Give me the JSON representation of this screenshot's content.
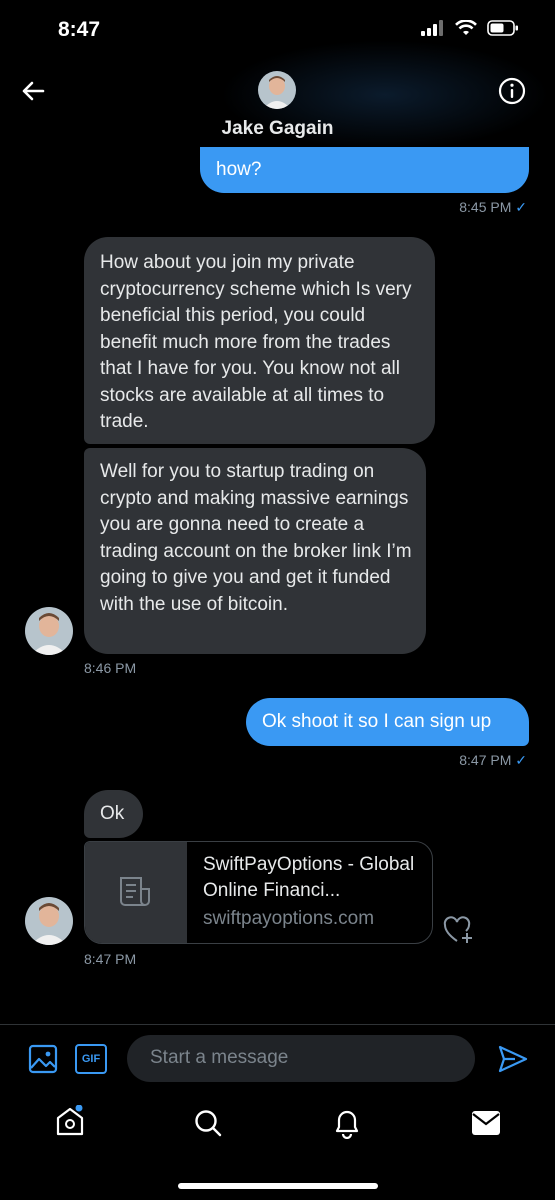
{
  "status": {
    "time": "8:47"
  },
  "header": {
    "title": "Jake Gagain"
  },
  "messages": [
    {
      "text": "how?",
      "time": "8:45 PM"
    },
    {
      "text": "How about you join my private cryptocurrency scheme which Is very beneficial this period, you could benefit much more from the trades that I have for you. You know not all stocks are available at all times to trade."
    },
    {
      "text": "Well for you to startup trading on crypto and making massive earnings you are gonna need to create a trading account on the broker link I’m going to give you and get it funded with the use of bitcoin.",
      "time": "8:46 PM"
    },
    {
      "text": "Ok shoot it so I can sign up",
      "time": "8:47 PM"
    },
    {
      "text": "Ok"
    },
    {
      "link_title": "SwiftPayOptions - Global Online Financi...",
      "link_domain": "swiftpayoptions.com",
      "time": "8:47 PM"
    }
  ],
  "composer": {
    "placeholder": "Start a message",
    "gif_label": "GIF"
  },
  "colors": {
    "accent": "#3a99f3",
    "incoming_bubble": "#303337",
    "background": "#000000"
  },
  "icons": [
    "back-arrow-icon",
    "info-icon",
    "image-icon",
    "gif-icon",
    "send-icon",
    "home-icon",
    "search-icon",
    "bell-icon",
    "mail-icon",
    "signal-icon",
    "wifi-icon",
    "battery-icon",
    "document-icon",
    "heart-plus-icon"
  ]
}
